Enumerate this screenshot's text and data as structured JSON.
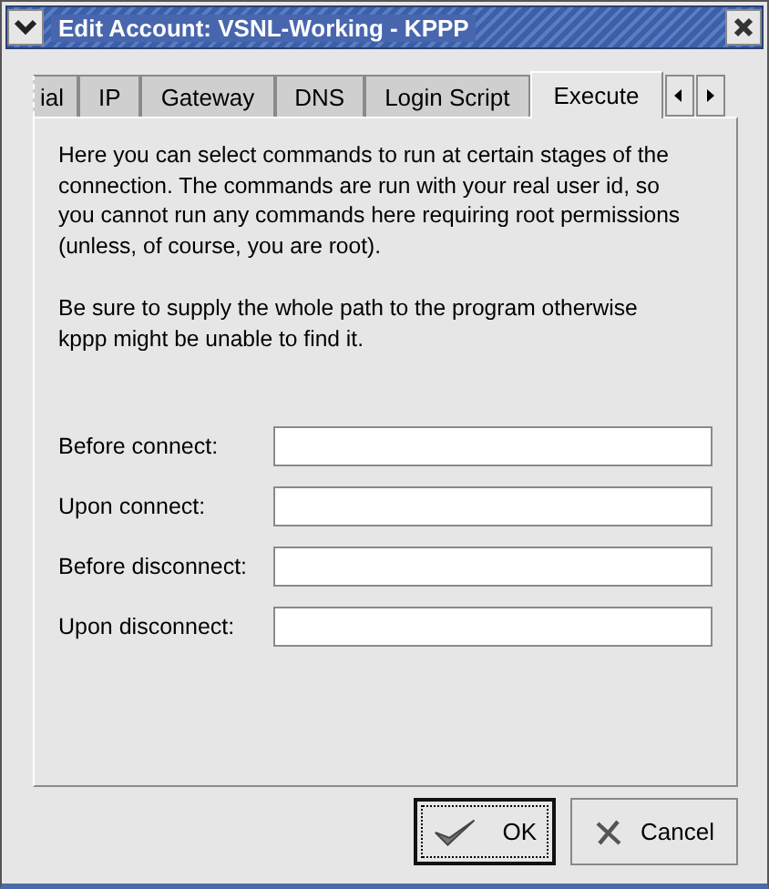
{
  "window": {
    "title": "Edit Account: VSNL-Working - KPPP"
  },
  "tabs": [
    {
      "label": "ial",
      "selected": false
    },
    {
      "label": "IP",
      "selected": false
    },
    {
      "label": "Gateway",
      "selected": false
    },
    {
      "label": "DNS",
      "selected": false
    },
    {
      "label": "Login Script",
      "selected": false
    },
    {
      "label": "Execute",
      "selected": true
    }
  ],
  "description": [
    "Here you can select commands to run at certain stages of the\nconnection. The commands are run with your real user id, so\nyou cannot run any commands here requiring root permissions\n(unless, of course, you are root).",
    "Be sure to supply the whole path to the program otherwise\nkppp might be unable to find it."
  ],
  "fields": [
    {
      "label": "Before connect:"
    },
    {
      "label": "Upon connect:"
    },
    {
      "label": "Before disconnect:"
    },
    {
      "label": "Upon disconnect:"
    }
  ],
  "buttons": [
    {
      "label": "OK",
      "kind": "ok",
      "default": true
    },
    {
      "label": "Cancel",
      "kind": "cancel",
      "default": false
    }
  ]
}
